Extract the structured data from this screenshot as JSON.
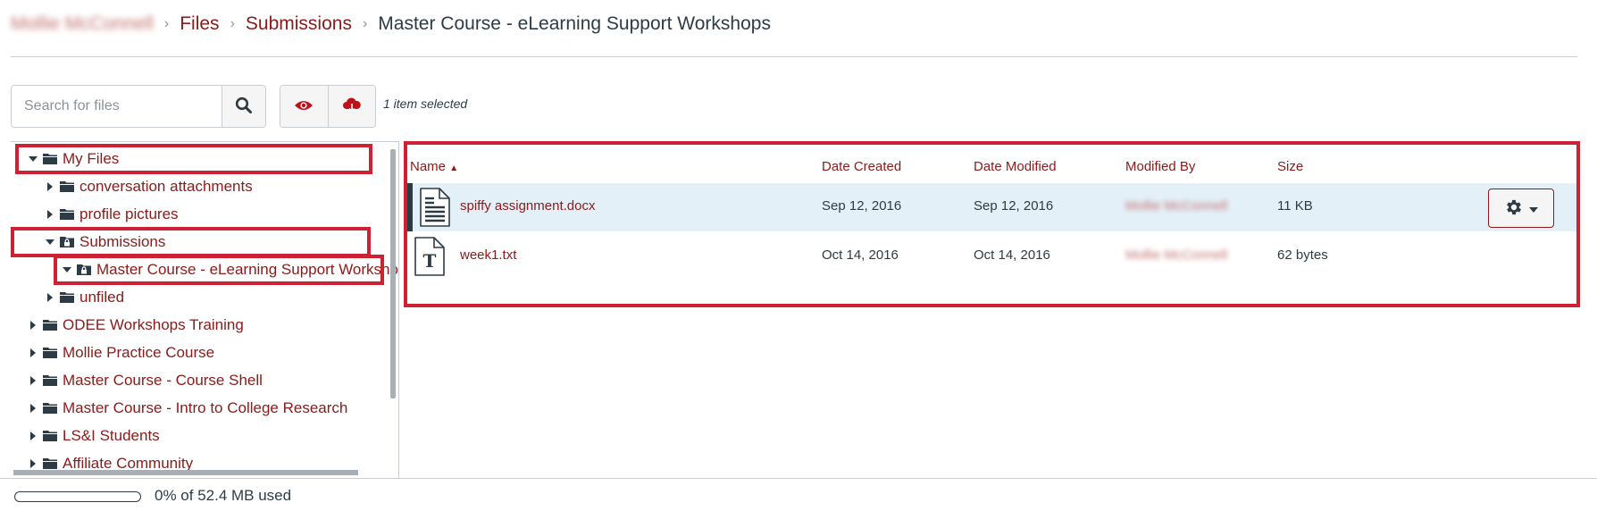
{
  "breadcrumb": {
    "user": "Mollie McConnell",
    "items": [
      "Files",
      "Submissions"
    ],
    "current": "Master Course - eLearning Support Workshops",
    "separator": "›"
  },
  "toolbar": {
    "search_placeholder": "Search for files",
    "search_value": "",
    "search_icon": "search-icon",
    "preview_icon": "eye-icon",
    "download_icon": "cloud-download-icon",
    "selected_label": "1 item selected"
  },
  "tree": {
    "items": [
      {
        "label": "My Files",
        "level": 0,
        "expanded": true,
        "icon": "folder-icon",
        "highlighted": true
      },
      {
        "label": "conversation attachments",
        "level": 1,
        "expanded": false,
        "icon": "folder-icon"
      },
      {
        "label": "profile pictures",
        "level": 1,
        "expanded": false,
        "icon": "folder-icon"
      },
      {
        "label": "Submissions",
        "level": 1,
        "expanded": true,
        "icon": "locked-folder-icon",
        "highlighted": true
      },
      {
        "label": "Master Course - eLearning Support Workshops",
        "level": 2,
        "expanded": true,
        "icon": "locked-folder-icon",
        "highlighted": true,
        "selected": true
      },
      {
        "label": "unfiled",
        "level": 1,
        "expanded": false,
        "icon": "folder-icon"
      },
      {
        "label": "ODEE Workshops Training",
        "level": 0,
        "expanded": false,
        "icon": "folder-icon"
      },
      {
        "label": "Mollie Practice Course",
        "level": 0,
        "expanded": false,
        "icon": "folder-icon"
      },
      {
        "label": "Master Course - Course Shell",
        "level": 0,
        "expanded": false,
        "icon": "folder-icon"
      },
      {
        "label": "Master Course - Intro to College Research",
        "level": 0,
        "expanded": false,
        "icon": "folder-icon"
      },
      {
        "label": "LS&I Students",
        "level": 0,
        "expanded": false,
        "icon": "folder-icon"
      },
      {
        "label": "Affiliate Community",
        "level": 0,
        "expanded": false,
        "icon": "folder-icon"
      }
    ]
  },
  "files": {
    "columns": [
      "Name",
      "Date Created",
      "Date Modified",
      "Modified By",
      "Size"
    ],
    "sort_indicator": "▲",
    "rows": [
      {
        "name": "spiffy assignment.docx",
        "icon": "document-icon",
        "created": "Sep 12, 2016",
        "modified": "Sep 12, 2016",
        "modified_by": "Mollie McConnell",
        "size": "11 KB",
        "selected": true
      },
      {
        "name": "week1.txt",
        "icon": "text-file-icon",
        "created": "Oct 14, 2016",
        "modified": "Oct 14, 2016",
        "modified_by": "Mollie McConnell",
        "size": "62 bytes",
        "selected": false
      }
    ],
    "settings_icon": "gear-icon"
  },
  "footer": {
    "quota_percent": 0,
    "quota_label": "0% of 52.4 MB used"
  },
  "colors": {
    "brand": "#8b1a1a",
    "highlight_box": "#cc2233",
    "text": "#2d3b45",
    "selected_row": "#e4f0f8",
    "icon_red": "#c0101a"
  }
}
